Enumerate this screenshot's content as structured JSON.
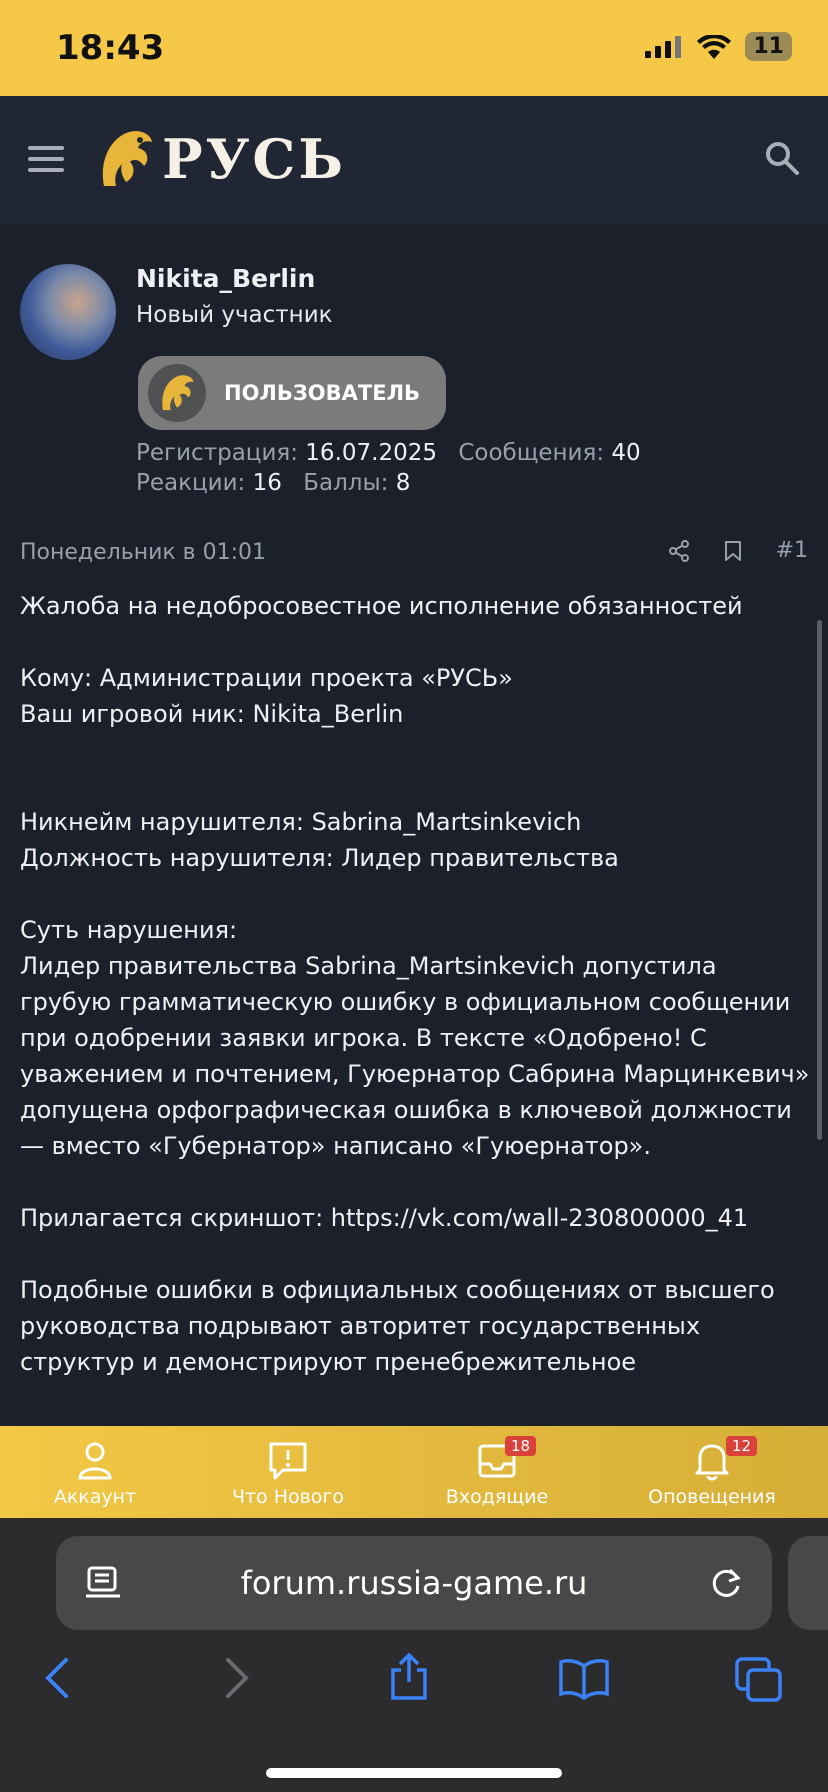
{
  "status": {
    "time": "18:43",
    "battery": "11"
  },
  "header": {
    "logo_text": "РУСЬ"
  },
  "user": {
    "name": "Nikita_Berlin",
    "title": "Новый участник",
    "badge": "ПОЛЬЗОВАТЕЛЬ",
    "stats": {
      "reg_label": "Регистрация:",
      "reg_value": "16.07.2025",
      "msg_label": "Сообщения:",
      "msg_value": "40",
      "react_label": "Реакции:",
      "react_value": "16",
      "points_label": "Баллы:",
      "points_value": "8"
    }
  },
  "post": {
    "date": "Понедельник в 01:01",
    "number": "#1",
    "body": "Жалоба на недобросовестное исполнение обязанностей\n\nКому: Администрации проекта «РУСЬ»\nВаш игровой ник: Nikita_Berlin\n\n\nНикнейм нарушителя: Sabrina_Martsinkevich\nДолжность нарушителя: Лидер правительства\n\nСуть нарушения:\nЛидер правительства Sabrina_Martsinkevich допустила грубую грамматическую ошибку в официальном сообщении при одобрении заявки игрока. В тексте «Одобрено! С уважением и почтением, Гуюернатор Сабрина Марцинкевич» допущена орфографическая ошибка в ключевой должности — вместо «Губернатор» написано «Гуюернатор».\n\nПрилагается скриншот: https://vk.com/wall-230800000_41\n\nПодобные ошибки в официальных сообщениях от высшего руководства подрывают авторитет государственных структур и демонстрируют пренебрежительное"
  },
  "bottom_nav": [
    {
      "label": "Аккаунт",
      "icon": "user-icon"
    },
    {
      "label": "Что Нового",
      "icon": "news-icon"
    },
    {
      "label": "Входящие",
      "icon": "inbox-icon",
      "badge": "18"
    },
    {
      "label": "Оповещения",
      "icon": "bell-icon",
      "badge": "12"
    }
  ],
  "browser": {
    "url": "forum.russia-game.ru"
  },
  "colors": {
    "accent": "#f5c847",
    "background": "#1b202b",
    "header": "#202633",
    "badge_red": "#d9423b"
  }
}
